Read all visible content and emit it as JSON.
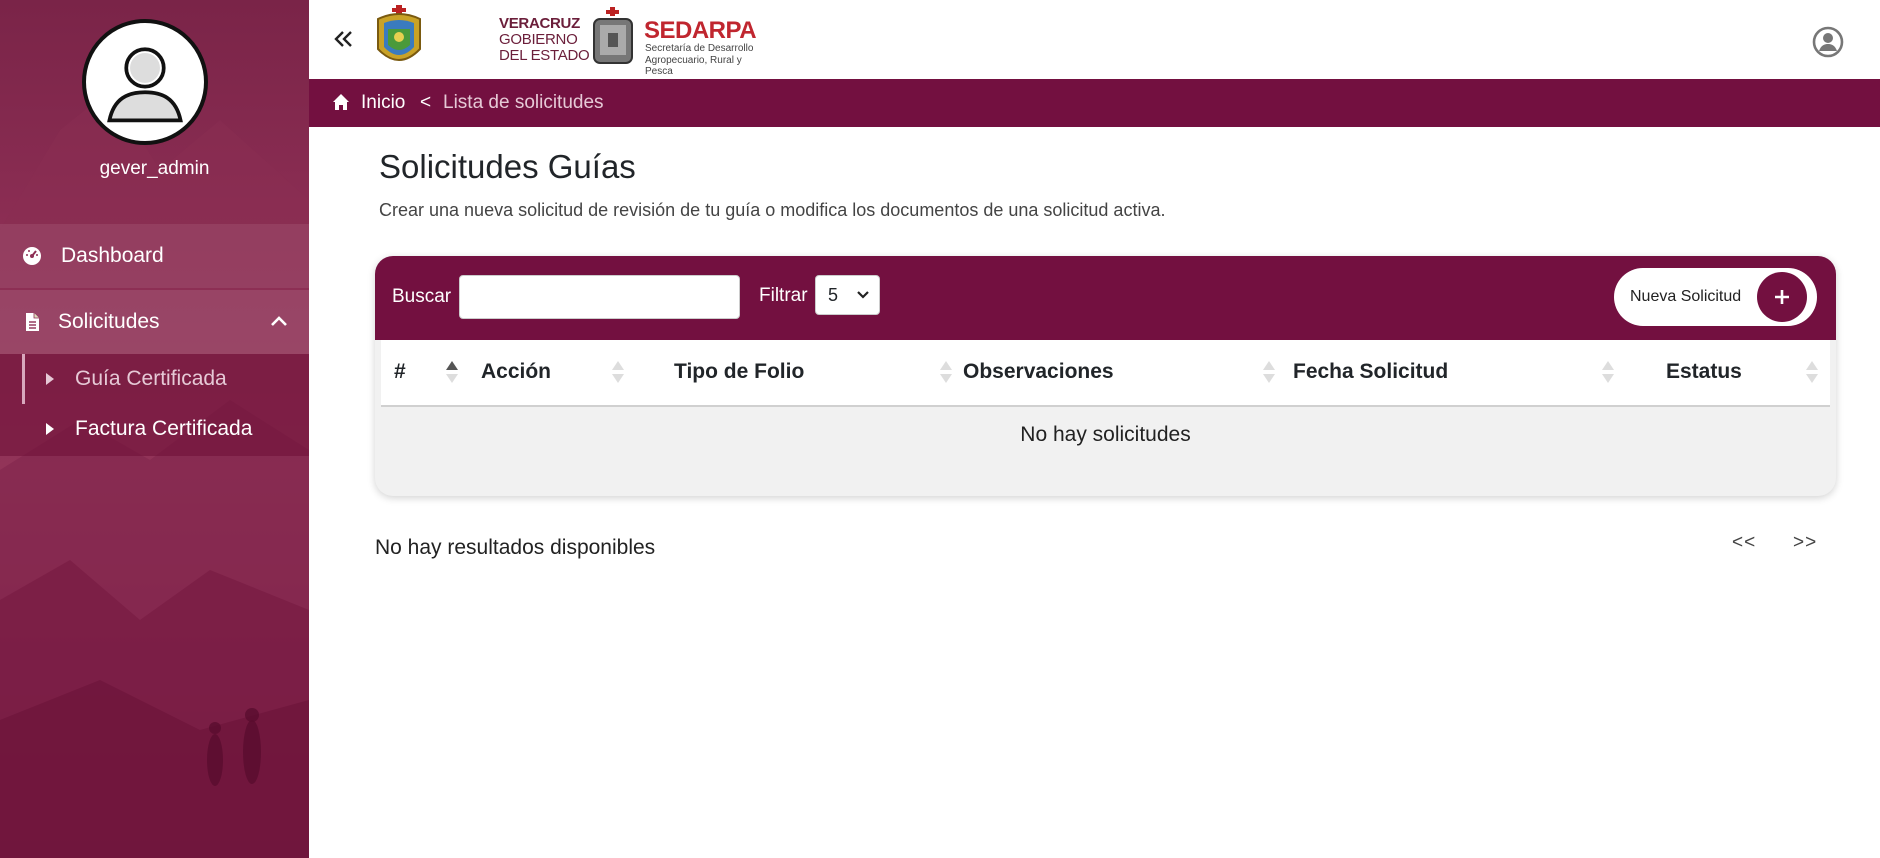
{
  "sidebar": {
    "username": "gever_admin",
    "items": [
      {
        "label": "Dashboard",
        "icon": "gauge-icon"
      },
      {
        "label": "Solicitudes",
        "icon": "document-icon",
        "expanded": true
      }
    ],
    "submenu": [
      {
        "label": "Guía Certificada",
        "active": true
      },
      {
        "label": "Factura Certificada",
        "active": false
      }
    ]
  },
  "header": {
    "logo": {
      "veracruz": "VERACRUZ",
      "gobierno": "GOBIERNO",
      "del_estado": "DEL ESTADO",
      "sedarpa": "SEDARPA",
      "sedarpa_line1": "Secretaría de Desarrollo",
      "sedarpa_line2": "Agropecuario, Rural y Pesca"
    }
  },
  "breadcrumb": {
    "home": "Inicio",
    "separator": "<",
    "current": "Lista de solicitudes"
  },
  "main": {
    "title": "Solicitudes Guías",
    "description": "Crear una nueva solicitud de revisión de tu guía o modifica los documentos de una solicitud activa.",
    "search_label": "Buscar",
    "search_value": "",
    "filter_label": "Filtrar",
    "filter_value": "5",
    "new_button_label": "Nueva Solicitud",
    "columns": [
      "#",
      "Acción",
      "Tipo de Folio",
      "Observaciones",
      "Fecha Solicitud",
      "Estatus"
    ],
    "empty_message": "No hay solicitudes",
    "no_results": "No hay resultados disponibles",
    "pagination": {
      "prev": "<<",
      "next": ">>"
    }
  },
  "colors": {
    "brand": "#731040",
    "sidebar": "#8e2f55",
    "background": "#ffffff"
  }
}
